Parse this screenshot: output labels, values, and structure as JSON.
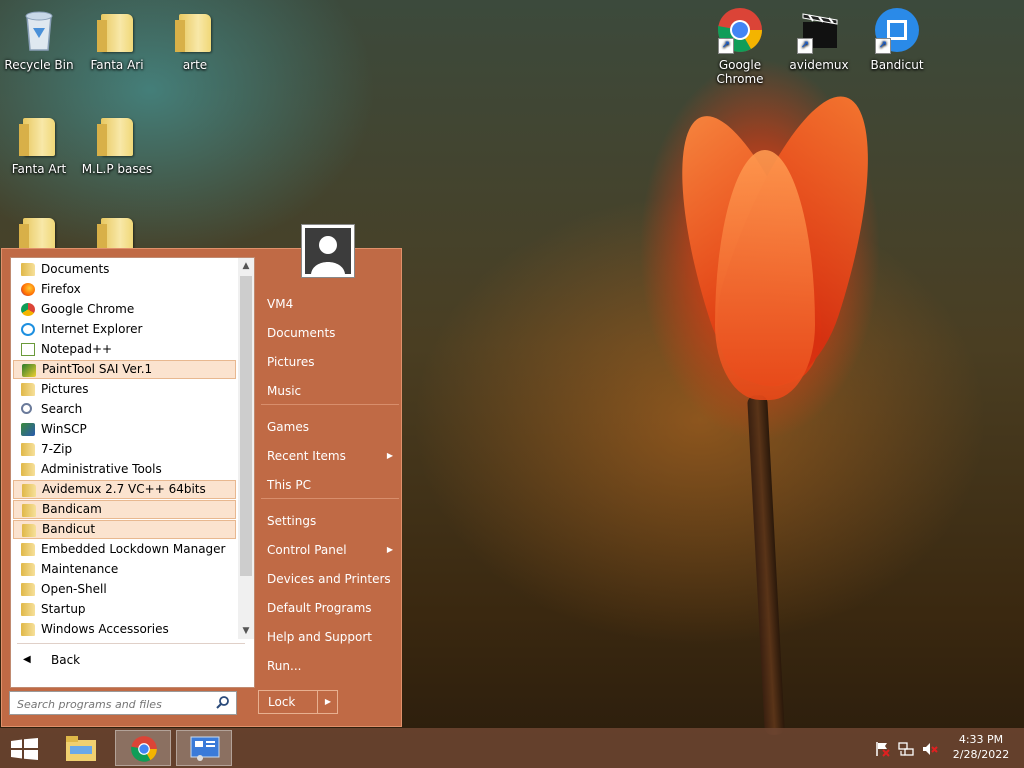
{
  "desktop": {
    "icons": [
      {
        "label": "Recycle Bin",
        "type": "recycle"
      },
      {
        "label": "Fanta Ari",
        "type": "folder"
      },
      {
        "label": "arte",
        "type": "folder"
      },
      {
        "label": "Fanta Art",
        "type": "folder"
      },
      {
        "label": "M.L.P bases",
        "type": "folder"
      },
      {
        "label": "Google Chrome",
        "type": "chrome"
      },
      {
        "label": "avidemux",
        "type": "clapper"
      },
      {
        "label": "Bandicut",
        "type": "bandicut"
      }
    ]
  },
  "start_menu": {
    "programs": [
      {
        "label": "Documents",
        "icon": "folder-icon",
        "highlighted": false
      },
      {
        "label": "Firefox",
        "icon": "firefox-icon",
        "highlighted": false
      },
      {
        "label": "Google Chrome",
        "icon": "chrome-icon",
        "highlighted": false
      },
      {
        "label": "Internet Explorer",
        "icon": "internet-explorer-icon",
        "highlighted": false
      },
      {
        "label": "Notepad++",
        "icon": "notepad-plus-plus-icon",
        "highlighted": false
      },
      {
        "label": "PaintTool SAI Ver.1",
        "icon": "painttool-sai-icon",
        "highlighted": true
      },
      {
        "label": "Pictures",
        "icon": "folder-icon",
        "highlighted": false
      },
      {
        "label": "Search",
        "icon": "search-icon",
        "highlighted": false
      },
      {
        "label": "WinSCP",
        "icon": "winscp-icon",
        "highlighted": false
      },
      {
        "label": "7-Zip",
        "icon": "folder-icon",
        "highlighted": false
      },
      {
        "label": "Administrative Tools",
        "icon": "folder-icon",
        "highlighted": false
      },
      {
        "label": "Avidemux 2.7 VC++ 64bits",
        "icon": "folder-icon",
        "highlighted": true
      },
      {
        "label": "Bandicam",
        "icon": "folder-icon",
        "highlighted": true
      },
      {
        "label": "Bandicut",
        "icon": "folder-icon",
        "highlighted": true
      },
      {
        "label": "Embedded Lockdown Manager",
        "icon": "folder-icon",
        "highlighted": false
      },
      {
        "label": "Maintenance",
        "icon": "folder-icon",
        "highlighted": false
      },
      {
        "label": "Open-Shell",
        "icon": "folder-icon",
        "highlighted": false
      },
      {
        "label": "Startup",
        "icon": "folder-icon",
        "highlighted": false
      },
      {
        "label": "Windows Accessories",
        "icon": "folder-icon",
        "highlighted": false
      }
    ],
    "back_label": "Back",
    "search_placeholder": "Search programs and files",
    "right_items": [
      {
        "label": "VM4",
        "submenu": false
      },
      {
        "label": "Documents",
        "submenu": false
      },
      {
        "label": "Pictures",
        "submenu": false
      },
      {
        "label": "Music",
        "submenu": false
      },
      {
        "label": "Games",
        "submenu": false
      },
      {
        "label": "Recent Items",
        "submenu": true
      },
      {
        "label": "This PC",
        "submenu": false
      },
      {
        "label": "Settings",
        "submenu": false
      },
      {
        "label": "Control Panel",
        "submenu": true
      },
      {
        "label": "Devices and Printers",
        "submenu": false
      },
      {
        "label": "Default Programs",
        "submenu": false
      },
      {
        "label": "Help and Support",
        "submenu": false
      },
      {
        "label": "Run...",
        "submenu": false
      }
    ],
    "lock_label": "Lock"
  },
  "taskbar": {
    "clock_time": "4:33 PM",
    "clock_date": "2/28/2022"
  },
  "colors": {
    "menu_bg": "#c06a45",
    "highlight": "#fbe3cf",
    "taskbar": "#6e4632"
  }
}
